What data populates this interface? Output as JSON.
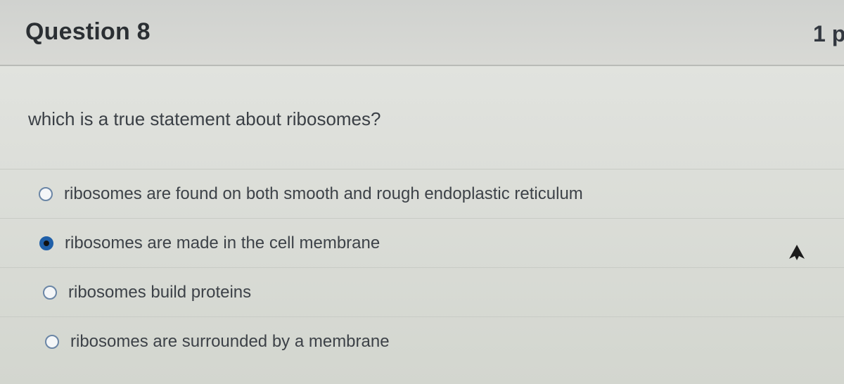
{
  "question": {
    "title": "Question 8",
    "points": "1 p",
    "prompt": "which is a true statement about ribosomes?",
    "answers": [
      {
        "label": "ribosomes are found on both smooth and rough endoplastic reticulum",
        "selected": false
      },
      {
        "label": "ribosomes are made in the cell membrane",
        "selected": true
      },
      {
        "label": "ribosomes build proteins",
        "selected": false
      },
      {
        "label": "ribosomes are surrounded by a membrane",
        "selected": false
      }
    ]
  },
  "icons": {
    "cursor": "mouse-pointer-icon",
    "radio": "radio-button-icon"
  },
  "colors": {
    "selected_radio": "#1f5fa8",
    "header_bg": "#d0d2cf",
    "text": "#3a3f45"
  }
}
